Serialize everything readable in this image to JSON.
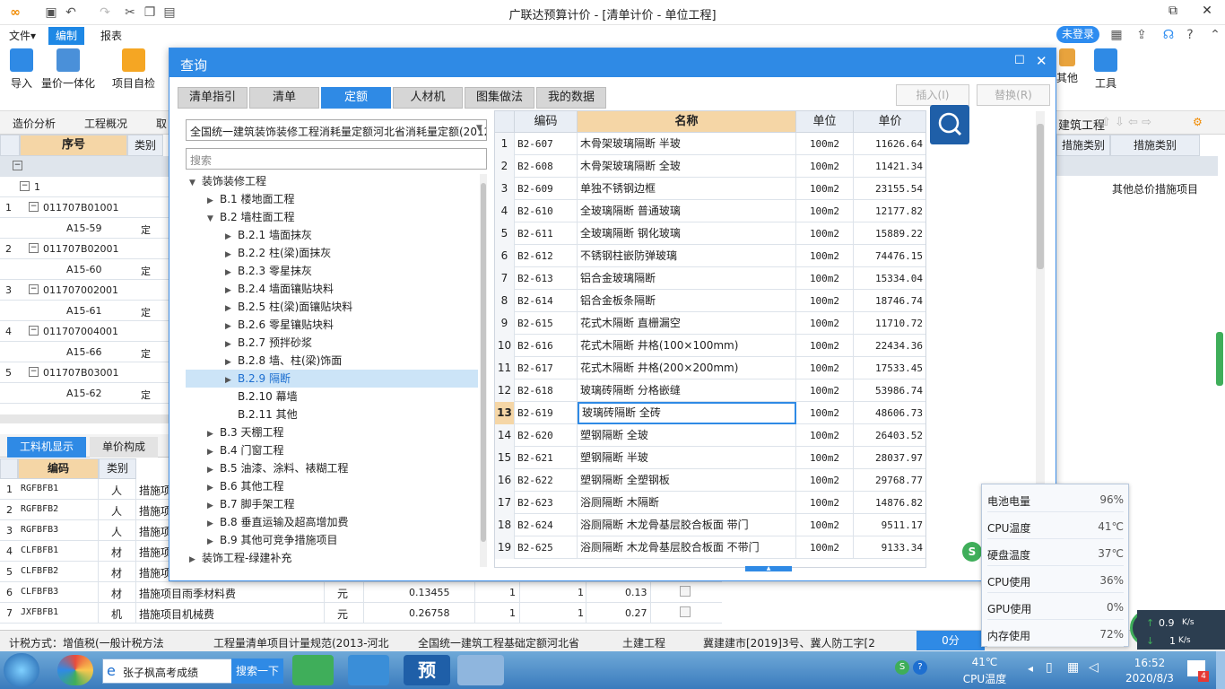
{
  "app": {
    "title": "广联达预算计价 - [清单计价 - 单位工程]"
  },
  "menu": {
    "file": "文件▾",
    "edit": "编制",
    "report": "报表",
    "login": "未登录"
  },
  "ribbon": {
    "import": "导入",
    "price_all": "量价一体化",
    "self_check": "项目自检",
    "other": "其他",
    "tools": "工具"
  },
  "subbar": {
    "cost_analysis": "造价分析",
    "overview": "工程概况",
    "cut": "取",
    "building": "建筑工程"
  },
  "left_grid": {
    "headers": {
      "seq": "序号",
      "type": "类别"
    },
    "rows": [
      {
        "num": "",
        "code": "",
        "type": ""
      },
      {
        "num": "",
        "code": "1",
        "type": ""
      },
      {
        "num": "1",
        "code": "011707B01001",
        "type": ""
      },
      {
        "num": "",
        "code": "A15-59",
        "type": "定"
      },
      {
        "num": "2",
        "code": "011707B02001",
        "type": ""
      },
      {
        "num": "",
        "code": "A15-60",
        "type": "定"
      },
      {
        "num": "3",
        "code": "011707002001",
        "type": ""
      },
      {
        "num": "",
        "code": "A15-61",
        "type": "定"
      },
      {
        "num": "4",
        "code": "011707004001",
        "type": ""
      },
      {
        "num": "",
        "code": "A15-66",
        "type": "定"
      },
      {
        "num": "5",
        "code": "011707B03001",
        "type": ""
      },
      {
        "num": "",
        "code": "A15-62",
        "type": "定"
      }
    ]
  },
  "right_grid": {
    "headers": {
      "measure_cat1": "措施类别",
      "measure_cat2": "措施类别"
    },
    "row_text": "其他总价措施项目"
  },
  "bottom_tabs": {
    "labor": "工料机显示",
    "unit_comp": "单价构成"
  },
  "bottom_grid": {
    "headers": {
      "code": "编码",
      "type": "类别"
    },
    "rows": [
      {
        "n": "1",
        "code": "RGFBFB1",
        "type": "人",
        "name": "措施项",
        "unit": "",
        "qty": "",
        "a": "",
        "b": "",
        "c": ""
      },
      {
        "n": "2",
        "code": "RGFBFB2",
        "type": "人",
        "name": "措施项",
        "unit": "",
        "qty": "",
        "a": "",
        "b": "",
        "c": ""
      },
      {
        "n": "3",
        "code": "RGFBFB3",
        "type": "人",
        "name": "措施项",
        "unit": "",
        "qty": "",
        "a": "",
        "b": "",
        "c": ""
      },
      {
        "n": "4",
        "code": "CLFBFB1",
        "type": "材",
        "name": "措施项",
        "unit": "",
        "qty": "",
        "a": "",
        "b": "",
        "c": ""
      },
      {
        "n": "5",
        "code": "CLFBFB2",
        "type": "材",
        "name": "措施项",
        "unit": "",
        "qty": "",
        "a": "",
        "b": "",
        "c": ""
      },
      {
        "n": "6",
        "code": "CLFBFB3",
        "type": "材",
        "name": "措施项目雨季材料费",
        "unit": "元",
        "qty": "0.13455",
        "a": "1",
        "b": "1",
        "c": "0.13"
      },
      {
        "n": "7",
        "code": "JXFBFB1",
        "type": "机",
        "name": "措施项目机械费",
        "unit": "元",
        "qty": "0.26758",
        "a": "1",
        "b": "1",
        "c": "0.27"
      }
    ]
  },
  "dialog": {
    "title": "查询",
    "tabs": [
      "清单指引",
      "清单",
      "定额",
      "人材机",
      "图集做法",
      "我的数据"
    ],
    "active_tab": "定额",
    "insert": "插入(I)",
    "replace": "替换(R)",
    "dropdown": "全国统一建筑装饰装修工程消耗量定额河北省消耗量定额(2012)",
    "search_placeholder": "搜索",
    "tree": [
      {
        "label": "装饰装修工程",
        "lvl": 0,
        "arrow": "▼"
      },
      {
        "label": "B.1 楼地面工程",
        "lvl": 1,
        "arrow": "▶"
      },
      {
        "label": "B.2 墙柱面工程",
        "lvl": 1,
        "arrow": "▼"
      },
      {
        "label": "B.2.1 墙面抹灰",
        "lvl": 2,
        "arrow": "▶"
      },
      {
        "label": "B.2.2 柱(梁)面抹灰",
        "lvl": 2,
        "arrow": "▶"
      },
      {
        "label": "B.2.3 零星抹灰",
        "lvl": 2,
        "arrow": "▶"
      },
      {
        "label": "B.2.4 墙面镶贴块料",
        "lvl": 2,
        "arrow": "▶"
      },
      {
        "label": "B.2.5 柱(梁)面镶贴块料",
        "lvl": 2,
        "arrow": "▶"
      },
      {
        "label": "B.2.6 零星镶贴块料",
        "lvl": 2,
        "arrow": "▶"
      },
      {
        "label": "B.2.7 预拌砂浆",
        "lvl": 2,
        "arrow": "▶"
      },
      {
        "label": "B.2.8 墙、柱(梁)饰面",
        "lvl": 2,
        "arrow": "▶"
      },
      {
        "label": "B.2.9 隔断",
        "lvl": 2,
        "arrow": "▶",
        "sel": true
      },
      {
        "label": "B.2.10 幕墙",
        "lvl": 2,
        "arrow": ""
      },
      {
        "label": "B.2.11 其他",
        "lvl": 2,
        "arrow": ""
      },
      {
        "label": "B.3 天棚工程",
        "lvl": 1,
        "arrow": "▶"
      },
      {
        "label": "B.4 门窗工程",
        "lvl": 1,
        "arrow": "▶"
      },
      {
        "label": "B.5 油漆、涂料、裱糊工程",
        "lvl": 1,
        "arrow": "▶"
      },
      {
        "label": "B.6 其他工程",
        "lvl": 1,
        "arrow": "▶"
      },
      {
        "label": "B.7 脚手架工程",
        "lvl": 1,
        "arrow": "▶"
      },
      {
        "label": "B.8 垂直运输及超高增加费",
        "lvl": 1,
        "arrow": "▶"
      },
      {
        "label": "B.9 其他可竞争措施项目",
        "lvl": 1,
        "arrow": "▶"
      },
      {
        "label": "装饰工程-绿建补充",
        "lvl": 0,
        "arrow": "▶"
      },
      {
        "label": "补充子目",
        "lvl": 0,
        "arrow": ""
      }
    ],
    "table_headers": {
      "code": "编码",
      "name": "名称",
      "unit": "单位",
      "price": "单价"
    },
    "rows": [
      {
        "n": "1",
        "code": "B2-607",
        "name": "木骨架玻璃隔断 半玻",
        "unit": "100m2",
        "price": "11626.64"
      },
      {
        "n": "2",
        "code": "B2-608",
        "name": "木骨架玻璃隔断 全玻",
        "unit": "100m2",
        "price": "11421.34"
      },
      {
        "n": "3",
        "code": "B2-609",
        "name": "单独不锈钢边框",
        "unit": "100m2",
        "price": "23155.54"
      },
      {
        "n": "4",
        "code": "B2-610",
        "name": "全玻璃隔断 普通玻璃",
        "unit": "100m2",
        "price": "12177.82"
      },
      {
        "n": "5",
        "code": "B2-611",
        "name": "全玻璃隔断 钢化玻璃",
        "unit": "100m2",
        "price": "15889.22"
      },
      {
        "n": "6",
        "code": "B2-612",
        "name": "不锈钢柱嵌防弹玻璃",
        "unit": "100m2",
        "price": "74476.15"
      },
      {
        "n": "7",
        "code": "B2-613",
        "name": "铝合金玻璃隔断",
        "unit": "100m2",
        "price": "15334.04"
      },
      {
        "n": "8",
        "code": "B2-614",
        "name": "铝合金板条隔断",
        "unit": "100m2",
        "price": "18746.74"
      },
      {
        "n": "9",
        "code": "B2-615",
        "name": "花式木隔断 直栅漏空",
        "unit": "100m2",
        "price": "11710.72"
      },
      {
        "n": "10",
        "code": "B2-616",
        "name": "花式木隔断 井格(100×100mm)",
        "unit": "100m2",
        "price": "22434.36"
      },
      {
        "n": "11",
        "code": "B2-617",
        "name": "花式木隔断 井格(200×200mm)",
        "unit": "100m2",
        "price": "17533.45"
      },
      {
        "n": "12",
        "code": "B2-618",
        "name": "玻璃砖隔断 分格嵌缝",
        "unit": "100m2",
        "price": "53986.74"
      },
      {
        "n": "13",
        "code": "B2-619",
        "name": "玻璃砖隔断 全砖",
        "unit": "100m2",
        "price": "48606.73"
      },
      {
        "n": "14",
        "code": "B2-620",
        "name": "塑钢隔断 全玻",
        "unit": "100m2",
        "price": "26403.52"
      },
      {
        "n": "15",
        "code": "B2-621",
        "name": "塑钢隔断 半玻",
        "unit": "100m2",
        "price": "28037.97"
      },
      {
        "n": "16",
        "code": "B2-622",
        "name": "塑钢隔断 全塑钢板",
        "unit": "100m2",
        "price": "29768.77"
      },
      {
        "n": "17",
        "code": "B2-623",
        "name": "浴厕隔断 木隔断",
        "unit": "100m2",
        "price": "14876.82"
      },
      {
        "n": "18",
        "code": "B2-624",
        "name": "浴厕隔断 木龙骨基层胶合板面 带门",
        "unit": "100m2",
        "price": "9511.17"
      },
      {
        "n": "19",
        "code": "B2-625",
        "name": "浴厕隔断 木龙骨基层胶合板面 不带门",
        "unit": "100m2",
        "price": "9133.34"
      }
    ],
    "selected_row": "13"
  },
  "status": {
    "tax": "计税方式：增值税(一般计税方法",
    "rule": "工程量清单项目计量规范(2013-河北",
    "quota": "全国统一建筑工程基础定额河北省",
    "civil": "土建工程",
    "doc": "冀建建市[2019]3号、冀人防工字[2",
    "score": "0分"
  },
  "sys_popup": [
    {
      "label": "电池电量",
      "value": "96%"
    },
    {
      "label": "CPU温度",
      "value": "41℃"
    },
    {
      "label": "硬盘温度",
      "value": "37℃"
    },
    {
      "label": "CPU使用",
      "value": "36%"
    },
    {
      "label": "GPU使用",
      "value": "0%"
    },
    {
      "label": "内存使用",
      "value": "72%"
    }
  ],
  "net": {
    "up": "0.9",
    "down": "1",
    "unit": "K/s"
  },
  "taskbar": {
    "search_text": "张子枫高考成绩",
    "search_btn": "搜索一下",
    "pre": "预",
    "cpu_temp": "41℃",
    "cpu_temp_label": "CPU温度",
    "time": "16:52",
    "date": "2020/8/3",
    "badge": "4"
  },
  "colors": {
    "accent": "#2f8ae5",
    "selected": "#cce4f7"
  }
}
